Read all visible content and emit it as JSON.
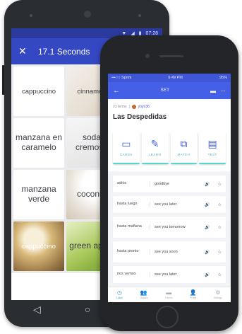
{
  "android": {
    "status": {
      "icons": [
        "▼",
        "◢",
        "▮"
      ],
      "time": "07:28"
    },
    "header": {
      "close_icon": "close-icon",
      "title": "17.1 Seconds"
    },
    "tiles": [
      {
        "label": "cappuccino",
        "style": "small"
      },
      {
        "label": "cinnamon",
        "style": "small-img",
        "image": "cinnamon"
      },
      {
        "label": "",
        "style": "img-extra"
      },
      {
        "label": "manzana en caramelo",
        "style": "big"
      },
      {
        "label": "soda cremosa",
        "style": "big-img",
        "image": "soda"
      },
      {
        "label": "",
        "style": "img-extra"
      },
      {
        "label": "manzana verde",
        "style": "big"
      },
      {
        "label": "coconut",
        "style": "big-img",
        "image": "coconut"
      },
      {
        "label": "",
        "style": "img-extra"
      },
      {
        "label": "cappuccino",
        "style": "small-img",
        "image": "cappuccino"
      },
      {
        "label": "green apple",
        "style": "big-img",
        "image": "apple"
      },
      {
        "label": "",
        "style": "img-extra"
      }
    ],
    "nav": {
      "back": "◁",
      "home": "○",
      "recent": "□"
    }
  },
  "iphone": {
    "status": {
      "carrier": "•••○○ Sprint",
      "time": "6:49 PM",
      "battery": "95%"
    },
    "header": {
      "title": "SET"
    },
    "set": {
      "term_count": "23 terms",
      "creator": "yoyo36",
      "title": "Las Despedidas"
    },
    "modes": [
      {
        "label": "CARDS",
        "icon": "cards-icon",
        "glyph": "▭"
      },
      {
        "label": "LEARN",
        "icon": "learn-icon",
        "glyph": "✎"
      },
      {
        "label": "MATCH",
        "icon": "match-icon",
        "glyph": "⧉"
      },
      {
        "label": "TEST",
        "icon": "test-icon",
        "glyph": "▤"
      }
    ],
    "terms": [
      {
        "word": "adiós",
        "definition": "goodbye"
      },
      {
        "word": "hasta luego",
        "definition": "see you later"
      },
      {
        "word": "hasta mañana",
        "definition": "see you tomorrow"
      },
      {
        "word": "hasta pronto",
        "definition": "see you soon"
      },
      {
        "word": "nos vemos",
        "definition": "see you later"
      }
    ],
    "tabs": [
      {
        "label": "Latest",
        "icon": "clock-icon",
        "glyph": "◷",
        "active": true
      },
      {
        "label": "Classes",
        "icon": "people-icon",
        "glyph": "👥",
        "active": false
      },
      {
        "label": "Folders",
        "icon": "folder-icon",
        "glyph": "▬",
        "active": false
      },
      {
        "label": "Profile",
        "icon": "profile-icon",
        "glyph": "👤",
        "active": false
      },
      {
        "label": "Settings",
        "icon": "gear-icon",
        "glyph": "⚙",
        "active": false
      }
    ]
  },
  "colors": {
    "android_header": "#3548c4",
    "iphone_header": "#4460e6",
    "mode_accent": "#55d6d0",
    "active_tab": "#4aa6d8"
  }
}
